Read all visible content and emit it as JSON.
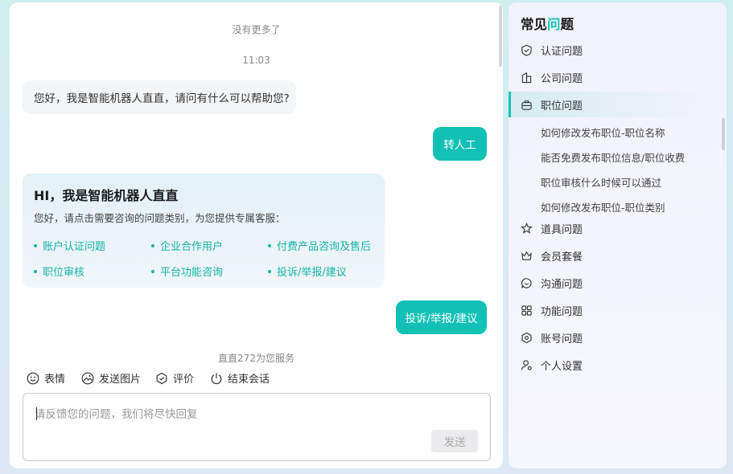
{
  "chat": {
    "no_more": "没有更多了",
    "time": "11:03",
    "bot_greeting": "您好，我是智能机器人直直，请问有什么可以帮助您?",
    "user_msg_1": "转人工",
    "card": {
      "title": "HI，我是智能机器人直直",
      "desc": "您好，请点击需要咨询的问题类别，为您提供专属客服：",
      "links": [
        "账户认证问题",
        "企业合作用户",
        "付费产品咨询及售后",
        "职位审核",
        "平台功能咨询",
        "投诉/举报/建议"
      ]
    },
    "user_msg_2": "投诉/举报/建议",
    "service_note": "直直272为您服务"
  },
  "toolbar": {
    "emoji": "表情",
    "send_image": "发送图片",
    "rate": "评价",
    "end_session": "结束会话"
  },
  "input": {
    "placeholder": "请反馈您的问题，我们将尽快回复",
    "send_label": "发送"
  },
  "faq": {
    "title_prefix": "常见",
    "title_accent": "问",
    "title_suffix": "题",
    "items": [
      {
        "label": "认证问题",
        "icon": "shield-icon"
      },
      {
        "label": "公司问题",
        "icon": "building-icon"
      },
      {
        "label": "职位问题",
        "icon": "briefcase-icon"
      },
      {
        "label": "道具问题",
        "icon": "star-tool-icon"
      },
      {
        "label": "会员套餐",
        "icon": "crown-icon"
      },
      {
        "label": "沟通问题",
        "icon": "chat-icon"
      },
      {
        "label": "功能问题",
        "icon": "grid-icon"
      },
      {
        "label": "账号问题",
        "icon": "hexagon-icon"
      },
      {
        "label": "个人设置",
        "icon": "user-gear-icon"
      }
    ],
    "sub_items": [
      "如何修改发布职位-职位名称",
      "能否免费发布职位信息/职位收费",
      "职位审核什么时候可以通过",
      "如何修改发布职位-职位类别"
    ]
  },
  "colors": {
    "accent": "#12c0b5",
    "link": "#14b3a8"
  }
}
